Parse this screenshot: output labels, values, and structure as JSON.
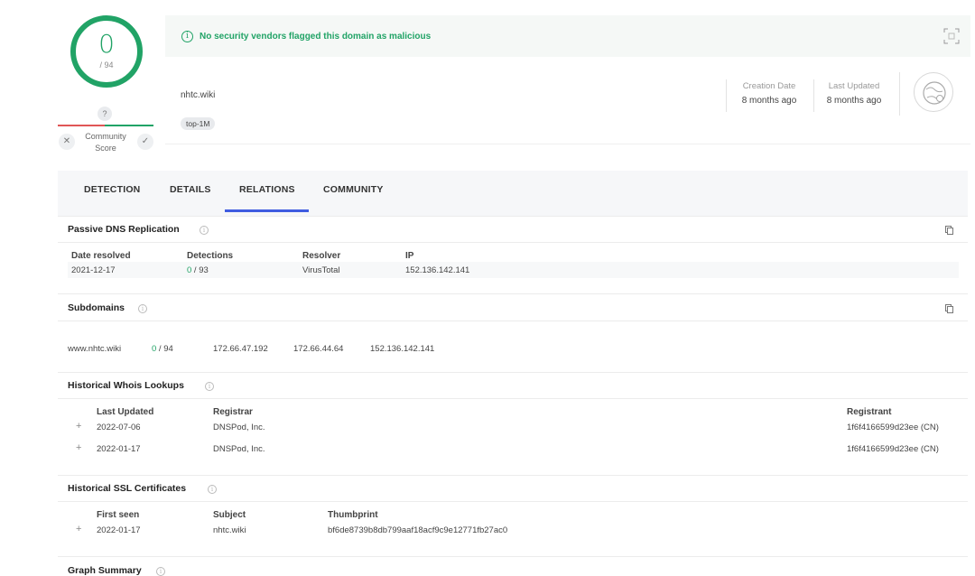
{
  "score": {
    "detections": "0",
    "total": "/ 94",
    "unknown_badge": "?"
  },
  "community": {
    "label_line1": "Community",
    "label_line2": "Score",
    "down_icon": "✕",
    "up_icon": "✓"
  },
  "banner": {
    "text": "No security vendors flagged this domain as malicious",
    "info_icon": "i"
  },
  "domain": {
    "name": "nhtc.wiki",
    "tag": "top-1M"
  },
  "meta": {
    "creation_label": "Creation Date",
    "creation_value": "8 months ago",
    "updated_label": "Last Updated",
    "updated_value": "8 months ago"
  },
  "tabs": [
    {
      "label": "DETECTION"
    },
    {
      "label": "DETAILS"
    },
    {
      "label": "RELATIONS"
    },
    {
      "label": "COMMUNITY"
    }
  ],
  "passive_dns": {
    "title": "Passive DNS Replication",
    "headers": {
      "date": "Date resolved",
      "detections": "Detections",
      "resolver": "Resolver",
      "ip": "IP"
    },
    "rows": [
      {
        "date": "2021-12-17",
        "det_hit": "0",
        "det_total": " / 93",
        "resolver": "VirusTotal",
        "ip": "152.136.142.141"
      }
    ]
  },
  "subdomains": {
    "title": "Subdomains",
    "rows": [
      {
        "domain": "www.nhtc.wiki",
        "det_hit": "0",
        "det_total": " / 94",
        "ip1": "172.66.47.192",
        "ip2": "172.66.44.64",
        "ip3": "152.136.142.141"
      }
    ]
  },
  "whois": {
    "title": "Historical Whois Lookups",
    "headers": {
      "updated": "Last Updated",
      "registrar": "Registrar",
      "registrant": "Registrant"
    },
    "rows": [
      {
        "updated": "2022-07-06",
        "registrar": "DNSPod, Inc.",
        "registrant": "1f6f4166599d23ee (CN)"
      },
      {
        "updated": "2022-01-17",
        "registrar": "DNSPod, Inc.",
        "registrant": "1f6f4166599d23ee (CN)"
      }
    ]
  },
  "ssl": {
    "title": "Historical SSL Certificates",
    "headers": {
      "first_seen": "First seen",
      "subject": "Subject",
      "thumbprint": "Thumbprint"
    },
    "rows": [
      {
        "first_seen": "2022-01-17",
        "subject": "nhtc.wiki",
        "thumbprint": "bf6de8739b8db799aaf18acf9c9e12771fb27ac0"
      }
    ]
  },
  "graph": {
    "title": "Graph Summary"
  },
  "common": {
    "info_icon": "i",
    "plus": "+"
  },
  "colors": {
    "accent_green": "#21a366",
    "accent_red": "#e05656",
    "tab_underline": "#3f5ce0"
  }
}
